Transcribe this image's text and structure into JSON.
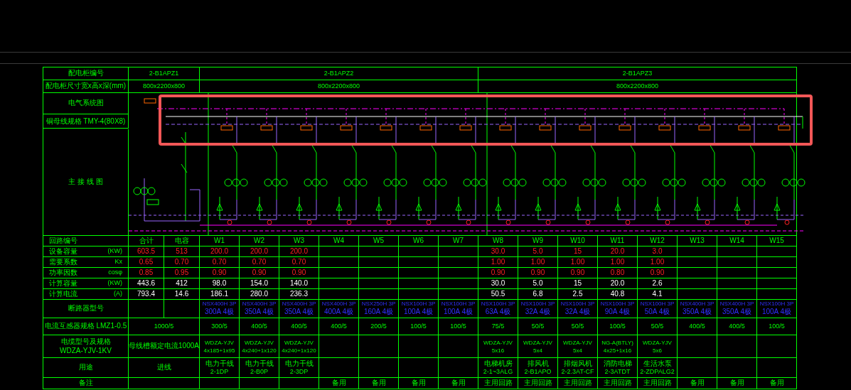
{
  "labels": {
    "number": "配电柜编号",
    "size": "配电柜尺寸宽x高x深(mm)",
    "system": "电气系统图",
    "busbar": "铜母线规格 TMY-4(80X8)",
    "diagram": "主 接 线 图",
    "rows": [
      {
        "label": "回路编号"
      },
      {
        "label": "设备容量",
        "unit": "(KW)"
      },
      {
        "label": "需要系数",
        "unit": "Kx"
      },
      {
        "label": "功率因数",
        "unit": "cosφ"
      },
      {
        "label": "计算容量",
        "unit": "(KW)"
      },
      {
        "label": "计算电流",
        "unit": "(A)"
      }
    ],
    "breaker": "断路器型号",
    "ct": "电流互感器规格 LMZ1-0.5",
    "cable": [
      "电缆型号及规格",
      "WDZA-YJV-1KV"
    ],
    "use": "用途",
    "remark": "备注"
  },
  "cabinets": [
    {
      "number": "2-B1APZ1",
      "size": "800x2200x800",
      "merged": {
        "ct": "1000/5",
        "cable": [
          "母线槽额定电流1000A"
        ],
        "use": [
          "进线"
        ]
      },
      "circuits": [
        {
          "values": [
            "合计",
            "603.5",
            "0.65",
            "0.85",
            "443.6",
            "793.4"
          ]
        },
        {
          "values": [
            "电容",
            "513",
            "0.70",
            "0.95",
            "412",
            "14.6"
          ]
        }
      ]
    },
    {
      "number": "2-B1APZ2",
      "size": "800x2200x800",
      "circuits": [
        {
          "values": [
            "W1",
            "200.0",
            "0.70",
            "0.90",
            "98.0",
            "186.1"
          ],
          "breaker": [
            "NSX400H 3P",
            "300A 4极"
          ],
          "ct": "300/5",
          "cable": [
            "WDZA-YJV",
            "4x185+1x95"
          ],
          "use": [
            "电力干线",
            "2-1DP"
          ]
        },
        {
          "values": [
            "W2",
            "200.0",
            "0.70",
            "0.90",
            "154.0",
            "280.0"
          ],
          "breaker": [
            "NSX400H 3P",
            "350A 4极"
          ],
          "ct": "400/5",
          "cable": [
            "WDZA-YJV",
            "4x240+1x120"
          ],
          "use": [
            "电力干线",
            "2-B0P"
          ]
        },
        {
          "values": [
            "W3",
            "200.0",
            "0.70",
            "0.90",
            "140.0",
            "236.3"
          ],
          "breaker": [
            "NSX400H 3P",
            "350A 4极"
          ],
          "ct": "400/5",
          "cable": [
            "WDZA-YJV",
            "4x240+1x120"
          ],
          "use": [
            "电力干线",
            "2-3DP"
          ]
        },
        {
          "values": [
            "W4"
          ],
          "breaker": [
            "NSX400H 3P",
            "400A 4极"
          ],
          "ct": "400/5",
          "remark": "备用"
        },
        {
          "values": [
            "W5"
          ],
          "breaker": [
            "NSX250H 3P",
            "160A 4极"
          ],
          "ct": "200/5",
          "remark": "备用"
        },
        {
          "values": [
            "W6"
          ],
          "breaker": [
            "NSX100H 3P",
            "100A 4极"
          ],
          "ct": "100/5",
          "remark": "备用"
        },
        {
          "values": [
            "W7"
          ],
          "breaker": [
            "NSX100H 3P",
            "100A 4极"
          ],
          "ct": "100/5",
          "remark": "备用"
        }
      ]
    },
    {
      "number": "2-B1APZ3",
      "size": "800x2200x800",
      "circuits": [
        {
          "values": [
            "W8",
            "30.0",
            "1.00",
            "0.90",
            "30.0",
            "50.5"
          ],
          "breaker": [
            "NSX100H 3P",
            "63A 4极"
          ],
          "ct": "75/5",
          "cable": [
            "WDZA-YJV",
            "5x16"
          ],
          "use": [
            "电梯机房",
            "2-1~3ALG"
          ],
          "remark": "主用回路"
        },
        {
          "values": [
            "W9",
            "5.0",
            "1.00",
            "0.90",
            "5.0",
            "6.8"
          ],
          "breaker": [
            "NSX100H 3P",
            "32A 4极"
          ],
          "ct": "50/5",
          "cable": [
            "WDZA-YJV",
            "5x4"
          ],
          "use": [
            "排风机",
            "2-B1APO"
          ],
          "remark": "主用回路"
        },
        {
          "values": [
            "W10",
            "15",
            "1.00",
            "0.90",
            "15",
            "2.5"
          ],
          "breaker": [
            "NSX100H 3P",
            "32A 4极"
          ],
          "ct": "50/5",
          "cable": [
            "WDZA-YJV",
            "5x4"
          ],
          "use": [
            "排烟风机",
            "2-2.3AT-CF"
          ],
          "remark": "主用回路"
        },
        {
          "values": [
            "W11",
            "20.0",
            "1.00",
            "0.80",
            "20.0",
            "40.8"
          ],
          "breaker": [
            "NSX100H 3P",
            "90A 4极"
          ],
          "ct": "100/5",
          "cable": [
            "NG-A(BTLY)",
            "4x25+1x16"
          ],
          "use": [
            "消防电梯",
            "2-3ATDT"
          ],
          "remark": "主用回路"
        },
        {
          "values": [
            "W12",
            "3.0",
            "1.00",
            "0.90",
            "2.6",
            "4.1"
          ],
          "breaker": [
            "NSX100H 3P",
            "50A 4极"
          ],
          "ct": "50/5",
          "cable": [
            "WDZA-YJV",
            "5x6"
          ],
          "use": [
            "生活水泵",
            "2-ZDPALG2"
          ],
          "remark": "主用回路"
        },
        {
          "values": [
            "W13"
          ],
          "breaker": [
            "NSX400H 3P",
            "350A 4极"
          ],
          "ct": "400/5",
          "remark": "备用"
        },
        {
          "values": [
            "W14"
          ],
          "breaker": [
            "NSX400H 3P",
            "350A 4极"
          ],
          "ct": "400/5",
          "remark": "备用"
        },
        {
          "values": [
            "W15"
          ],
          "breaker": [
            "NSX100H 3P",
            "100A 4极"
          ],
          "ct": "100/5",
          "remark": "备用"
        }
      ]
    }
  ]
}
